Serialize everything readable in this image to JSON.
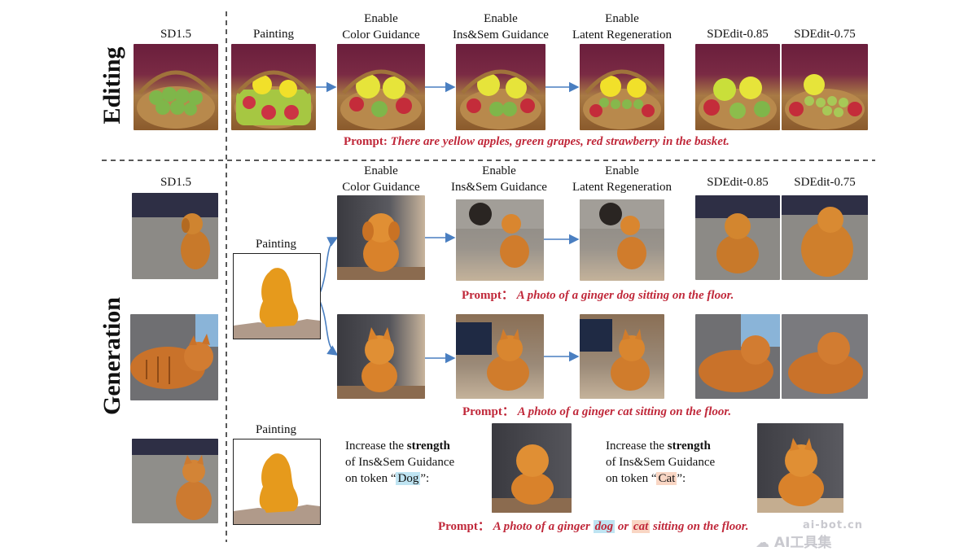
{
  "sections": {
    "editing": "Editing",
    "generation": "Generation"
  },
  "editing": {
    "sd": "SD1.5",
    "painting": "Painting",
    "col1": [
      "Enable",
      "Color Guidance"
    ],
    "col2": [
      "Enable",
      "Ins&Sem Guidance"
    ],
    "col3": [
      "Enable",
      "Latent Regeneration"
    ],
    "sde1": "SDEdit-0.85",
    "sde2": "SDEdit-0.75",
    "prompt_label": "Prompt:",
    "prompt_text": "There are yellow apples, green grapes, red strawberry in the basket."
  },
  "generation": {
    "sd": "SD1.5",
    "painting1": "Painting",
    "painting2": "Painting",
    "col1": [
      "Enable",
      "Color Guidance"
    ],
    "col2": [
      "Enable",
      "Ins&Sem Guidance"
    ],
    "col3": [
      "Enable",
      "Latent Regeneration"
    ],
    "sde1": "SDEdit-0.85",
    "sde2": "SDEdit-0.75",
    "dog_prompt_label": "Prompt：",
    "dog_prompt_text": "A photo of a ginger dog sitting on the floor.",
    "cat_prompt_label": "Prompt：",
    "cat_prompt_text": "A photo of a ginger cat sitting on the floor.",
    "note_dog": {
      "pre": "Increase the ",
      "bold": "strength",
      "line2": "of Ins&Sem Guidance",
      "line3_pre": "on token “",
      "token": "Dog",
      "line3_post": "”:"
    },
    "note_cat": {
      "pre": "Increase the ",
      "bold": "strength",
      "line2": "of Ins&Sem Guidance",
      "line3_pre": "on token “",
      "token": "Cat",
      "line3_post": "”:"
    },
    "final_prompt_label": "Prompt：",
    "final_prompt_a": "A photo of a ginger ",
    "final_token_dog": "dog",
    "final_or": " or ",
    "final_token_cat": "cat",
    "final_prompt_b": " sitting on the floor."
  },
  "watermark": {
    "line1": "ai-bot.cn",
    "line2": "AI工具集"
  },
  "colors": {
    "prompt": "#c0283a",
    "arrow": "#4a7fc1",
    "paint_orange": "#e69a1c",
    "paint_floor": "#b09a8a",
    "token_dog": "#bfe4f2",
    "token_cat": "#f9d6c4"
  }
}
